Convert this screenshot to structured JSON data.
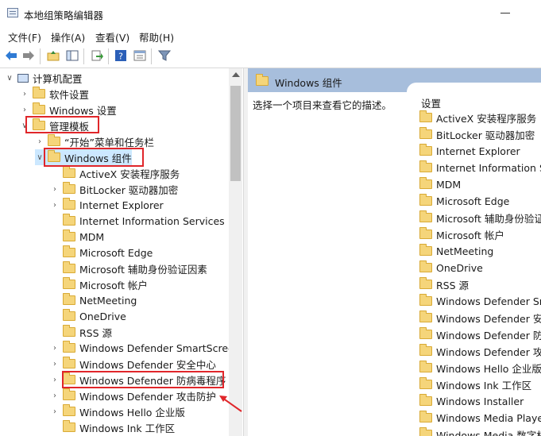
{
  "window": {
    "title": "本地组策略编辑器"
  },
  "menu": [
    "文件(F)",
    "操作(A)",
    "查看(V)",
    "帮助(H)"
  ],
  "toolbar": [
    "back-arrow-icon",
    "forward-arrow-icon",
    "up-folder-icon",
    "show-hide-tree-icon",
    "export-list-icon",
    "help-icon",
    "properties-icon",
    "filter-icon"
  ],
  "tree": [
    {
      "label": "计算机配置",
      "indent": 0,
      "expander": "v",
      "icon": "computer"
    },
    {
      "label": "软件设置",
      "indent": 1,
      "expander": ">",
      "icon": "folder"
    },
    {
      "label": "Windows 设置",
      "indent": 1,
      "expander": ">",
      "icon": "folder"
    },
    {
      "label": "管理模板",
      "indent": 1,
      "expander": "v",
      "icon": "folder"
    },
    {
      "label": "“开始”菜单和任务栏",
      "indent": 2,
      "expander": ">",
      "icon": "folder"
    },
    {
      "label": "Windows 组件",
      "indent": 2,
      "expander": "v",
      "icon": "folder"
    },
    {
      "label": "ActiveX 安装程序服务",
      "indent": 3,
      "expander": "",
      "icon": "folder"
    },
    {
      "label": "BitLocker 驱动器加密",
      "indent": 3,
      "expander": ">",
      "icon": "folder"
    },
    {
      "label": "Internet Explorer",
      "indent": 3,
      "expander": ">",
      "icon": "folder"
    },
    {
      "label": "Internet Information Services",
      "indent": 3,
      "expander": "",
      "icon": "folder"
    },
    {
      "label": "MDM",
      "indent": 3,
      "expander": "",
      "icon": "folder"
    },
    {
      "label": "Microsoft Edge",
      "indent": 3,
      "expander": "",
      "icon": "folder"
    },
    {
      "label": "Microsoft 辅助身份验证因素",
      "indent": 3,
      "expander": "",
      "icon": "folder"
    },
    {
      "label": "Microsoft 帐户",
      "indent": 3,
      "expander": "",
      "icon": "folder"
    },
    {
      "label": "NetMeeting",
      "indent": 3,
      "expander": "",
      "icon": "folder"
    },
    {
      "label": "OneDrive",
      "indent": 3,
      "expander": "",
      "icon": "folder"
    },
    {
      "label": "RSS 源",
      "indent": 3,
      "expander": "",
      "icon": "folder"
    },
    {
      "label": "Windows Defender SmartScreen",
      "indent": 3,
      "expander": ">",
      "icon": "folder"
    },
    {
      "label": "Windows Defender 安全中心",
      "indent": 3,
      "expander": ">",
      "icon": "folder"
    },
    {
      "label": "Windows Defender 防病毒程序",
      "indent": 3,
      "expander": ">",
      "icon": "folder"
    },
    {
      "label": "Windows Defender 攻击防护",
      "indent": 3,
      "expander": ">",
      "icon": "folder"
    },
    {
      "label": "Windows Hello 企业版",
      "indent": 3,
      "expander": ">",
      "icon": "folder"
    },
    {
      "label": "Windows Ink 工作区",
      "indent": 3,
      "expander": "",
      "icon": "folder"
    }
  ],
  "right": {
    "header": "Windows 组件",
    "description": "选择一个项目来查看它的描述。",
    "column": "设置",
    "items": [
      "ActiveX 安装程序服务",
      "BitLocker 驱动器加密",
      "Internet Explorer",
      "Internet Information Se",
      "MDM",
      "Microsoft Edge",
      "Microsoft 辅助身份验证",
      "Microsoft 帐户",
      "NetMeeting",
      "OneDrive",
      "RSS 源",
      "Windows Defender Sma",
      "Windows Defender 安全",
      "Windows Defender 防病",
      "Windows Defender 攻击",
      "Windows Hello 企业版",
      "Windows Ink 工作区",
      "Windows Installer",
      "Windows Media Player",
      "Windows Media 数字权"
    ]
  },
  "colors": {
    "highlight": "#e0262a",
    "header_bg": "#a7bedc",
    "selection": "#cce8ff"
  }
}
